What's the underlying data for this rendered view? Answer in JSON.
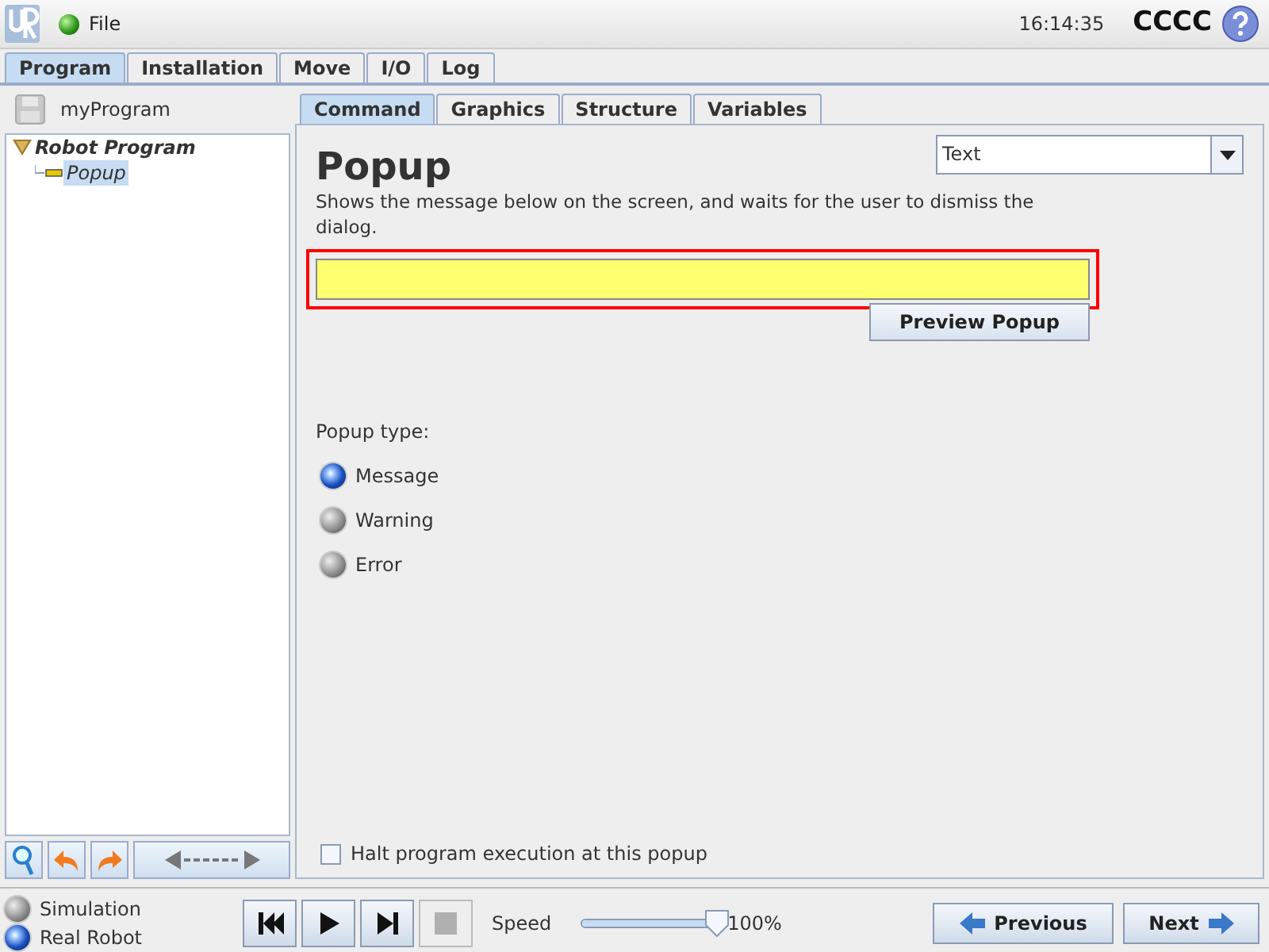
{
  "top_bar": {
    "menu": "File",
    "time": "16:14:35",
    "robot_name": "CCCC"
  },
  "main_tabs": [
    {
      "label": "Program",
      "selected": true
    },
    {
      "label": "Installation",
      "selected": false
    },
    {
      "label": "Move",
      "selected": false
    },
    {
      "label": "I/O",
      "selected": false
    },
    {
      "label": "Log",
      "selected": false
    }
  ],
  "program": {
    "name": "myProgram",
    "tree": [
      {
        "label": "Robot Program",
        "expanded": true,
        "selected": false,
        "children": [
          {
            "label": "Popup",
            "selected": true
          }
        ]
      }
    ]
  },
  "sub_tabs": [
    {
      "label": "Command",
      "selected": true
    },
    {
      "label": "Graphics",
      "selected": false
    },
    {
      "label": "Structure",
      "selected": false
    },
    {
      "label": "Variables",
      "selected": false
    }
  ],
  "command": {
    "title": "Popup",
    "type_select": "Text",
    "description": "Shows the message below on the screen, and waits for the user to dismiss the dialog.",
    "message_invalid": true,
    "preview_button": "Preview Popup",
    "popup_type_label": "Popup type:",
    "popup_types": [
      {
        "label": "Message",
        "selected": true
      },
      {
        "label": "Warning",
        "selected": false
      },
      {
        "label": "Error",
        "selected": false
      }
    ],
    "halt": {
      "label": "Halt program execution at this popup",
      "checked": false
    }
  },
  "footer": {
    "modes": [
      {
        "label": "Simulation",
        "selected": false
      },
      {
        "label": "Real Robot",
        "selected": true
      }
    ],
    "speed_label": "Speed",
    "speed": {
      "level": 1
    },
    "speed_reading": "100%",
    "previous": "Previous",
    "next": "Next"
  }
}
